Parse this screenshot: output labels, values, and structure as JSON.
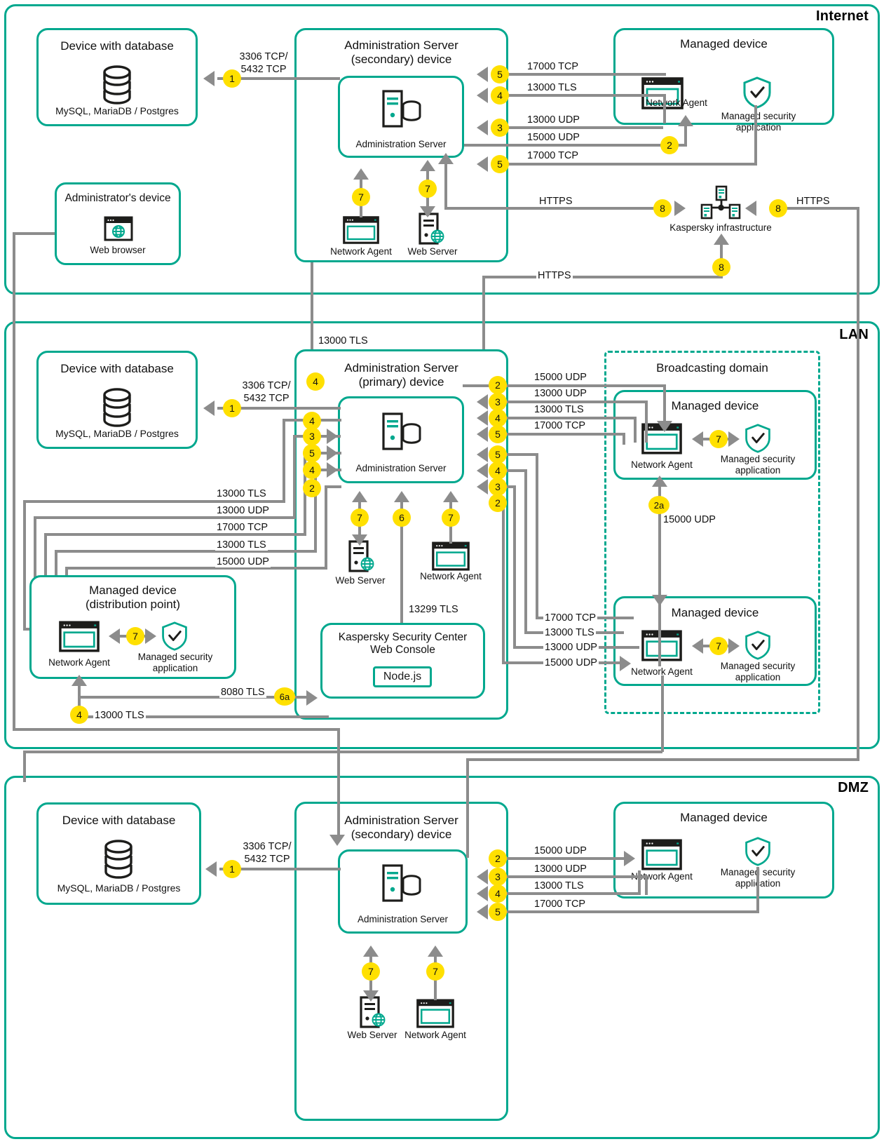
{
  "zones": {
    "internet": {
      "title": "Internet"
    },
    "lan": {
      "title": "LAN"
    },
    "dmz": {
      "title": "DMZ"
    }
  },
  "labels": {
    "device_with_database": "Device with database",
    "db_engines": "MySQL, MariaDB / Postgres",
    "admin_server_secondary": "Administration Server\n(secondary) device",
    "admin_server_secondary_l1": "Administration Server",
    "admin_server_secondary_l2": "(secondary) device",
    "admin_server_primary_l1": "Administration Server",
    "admin_server_primary_l2": "(primary) device",
    "administration_server": "Administration Server",
    "managed_device": "Managed device",
    "managed_device_dp_l1": "Managed device",
    "managed_device_dp_l2": "(distribution point)",
    "network_agent": "Network Agent",
    "managed_security_application_l1": "Managed security",
    "managed_security_application_l2": "application",
    "administrators_device": "Administrator's device",
    "web_browser": "Web browser",
    "web_server": "Web Server",
    "kaspersky_infrastructure": "Kaspersky infrastructure",
    "broadcasting_domain": "Broadcasting domain",
    "ksc_web_console_l1": "Kaspersky Security Center",
    "ksc_web_console_l2": "Web Console",
    "nodejs": "Node.js"
  },
  "ports": {
    "db": "3306 TCP/\n5432 TCP",
    "db_l1": "3306 TCP/",
    "db_l2": "5432 TCP",
    "p17000tcp": "17000 TCP",
    "p13000tls": "13000 TLS",
    "p13000udp": "13000 UDP",
    "p15000udp": "15000 UDP",
    "p8080tls": "8080 TLS",
    "p13299tls": "13299 TLS",
    "https": "HTTPS"
  },
  "badges": {
    "b1": "1",
    "b2": "2",
    "b2a": "2a",
    "b3": "3",
    "b4": "4",
    "b5": "5",
    "b6": "6",
    "b6a": "6a",
    "b7": "7",
    "b8": "8"
  },
  "colors": {
    "accent": "#00a88e",
    "line": "#8c8c8c",
    "badge": "#ffe000",
    "text": "#111111",
    "icon_dark": "#1d1d1b"
  },
  "internet": {
    "database_box": {
      "title": "Device with database",
      "caption": "MySQL, MariaDB / Postgres"
    },
    "admin_box": {
      "title_l1": "Administration Server",
      "title_l2": "(secondary) device",
      "node": "Administration Server"
    },
    "managed_device": {
      "title": "Managed device",
      "agent": "Network Agent",
      "app_l1": "Managed security",
      "app_l2": "application"
    },
    "admin_device": {
      "title": "Administrator's device",
      "node": "Web browser"
    },
    "flows": [
      {
        "badge": "1",
        "port_l1": "3306 TCP/",
        "port_l2": "5432 TCP"
      },
      {
        "badge": "5",
        "port": "17000 TCP"
      },
      {
        "badge": "4",
        "port": "13000 TLS"
      },
      {
        "badge": "3",
        "port": "13000 UDP"
      },
      {
        "badge": "2",
        "port": "15000 UDP"
      },
      {
        "badge": "5",
        "port": "17000 TCP"
      },
      {
        "badge": "8",
        "port": "HTTPS"
      },
      {
        "badge": "8",
        "port": "HTTPS"
      },
      {
        "badge": "8",
        "port": "HTTPS"
      }
    ],
    "agents": [
      {
        "badge": "7",
        "node": "Network Agent"
      },
      {
        "badge": "7",
        "node": "Web Server"
      }
    ],
    "kaspersky": "Kaspersky infrastructure"
  },
  "lan": {
    "database_box": {
      "title": "Device with database",
      "caption": "MySQL, MariaDB / Postgres"
    },
    "admin_box": {
      "title_l1": "Administration Server",
      "title_l2": "(primary) device",
      "node": "Administration Server"
    },
    "uplink": {
      "badge": "4",
      "port": "13000 TLS"
    },
    "left_flows": [
      {
        "badge": "1",
        "port_l1": "3306 TCP/",
        "port_l2": "5432 TCP"
      },
      {
        "badge": "4",
        "port": "13000 TLS"
      },
      {
        "badge": "3",
        "port": "13000 UDP"
      },
      {
        "badge": "5",
        "port": "17000 TCP"
      },
      {
        "badge": "4",
        "port": "13000 TLS"
      },
      {
        "badge": "2",
        "port": "15000 UDP"
      }
    ],
    "right_top_flows": [
      {
        "badge": "2",
        "port": "15000 UDP"
      },
      {
        "badge": "3",
        "port": "13000 UDP"
      },
      {
        "badge": "4",
        "port": "13000 TLS"
      },
      {
        "badge": "5",
        "port": "17000 TCP"
      }
    ],
    "right_bottom_flows": [
      {
        "badge": "5",
        "port": "17000 TCP"
      },
      {
        "badge": "4",
        "port": "13000 TLS"
      },
      {
        "badge": "3",
        "port": "13000 UDP"
      },
      {
        "badge": "2",
        "port": "15000 UDP"
      }
    ],
    "broadcast": {
      "title": "Broadcasting domain",
      "device_top": {
        "title": "Managed device",
        "agent": "Network Agent",
        "app_l1": "Managed security",
        "app_l2": "application",
        "badge": "7"
      },
      "device_bottom": {
        "title": "Managed device",
        "agent": "Network Agent",
        "app_l1": "Managed security",
        "app_l2": "application",
        "badge": "7"
      },
      "inner_flow": {
        "badge": "2a",
        "port": "15000 UDP"
      }
    },
    "distribution_point": {
      "title_l1": "Managed device",
      "title_l2": "(distribution point)",
      "agent": "Network Agent",
      "app_l1": "Managed security",
      "app_l2": "application",
      "badge": "7",
      "downlink": {
        "badge": "4",
        "port": "13000 TLS"
      }
    },
    "console": {
      "title_l1": "Kaspersky Security Center",
      "title_l2": "Web Console",
      "runtime": "Node.js",
      "to_server": {
        "badge": "6",
        "port": "13299 TLS"
      },
      "from_dp": {
        "badge": "6a",
        "port": "8080 TLS"
      }
    },
    "agents": [
      {
        "badge": "7",
        "node": "Web Server"
      },
      {
        "badge": "7",
        "node": "Network Agent"
      }
    ]
  },
  "dmz": {
    "database_box": {
      "title": "Device with database",
      "caption": "MySQL, MariaDB / Postgres"
    },
    "admin_box": {
      "title_l1": "Administration Server",
      "title_l2": "(secondary) device",
      "node": "Administration Server"
    },
    "managed_device": {
      "title": "Managed device",
      "agent": "Network Agent",
      "app_l1": "Managed security",
      "app_l2": "application"
    },
    "flows": [
      {
        "badge": "1",
        "port_l1": "3306 TCP/",
        "port_l2": "5432 TCP"
      },
      {
        "badge": "2",
        "port": "15000 UDP"
      },
      {
        "badge": "3",
        "port": "13000 UDP"
      },
      {
        "badge": "4",
        "port": "13000 TLS"
      },
      {
        "badge": "5",
        "port": "17000 TCP"
      }
    ],
    "agents": [
      {
        "badge": "7",
        "node": "Web Server"
      },
      {
        "badge": "7",
        "node": "Network Agent"
      }
    ]
  }
}
